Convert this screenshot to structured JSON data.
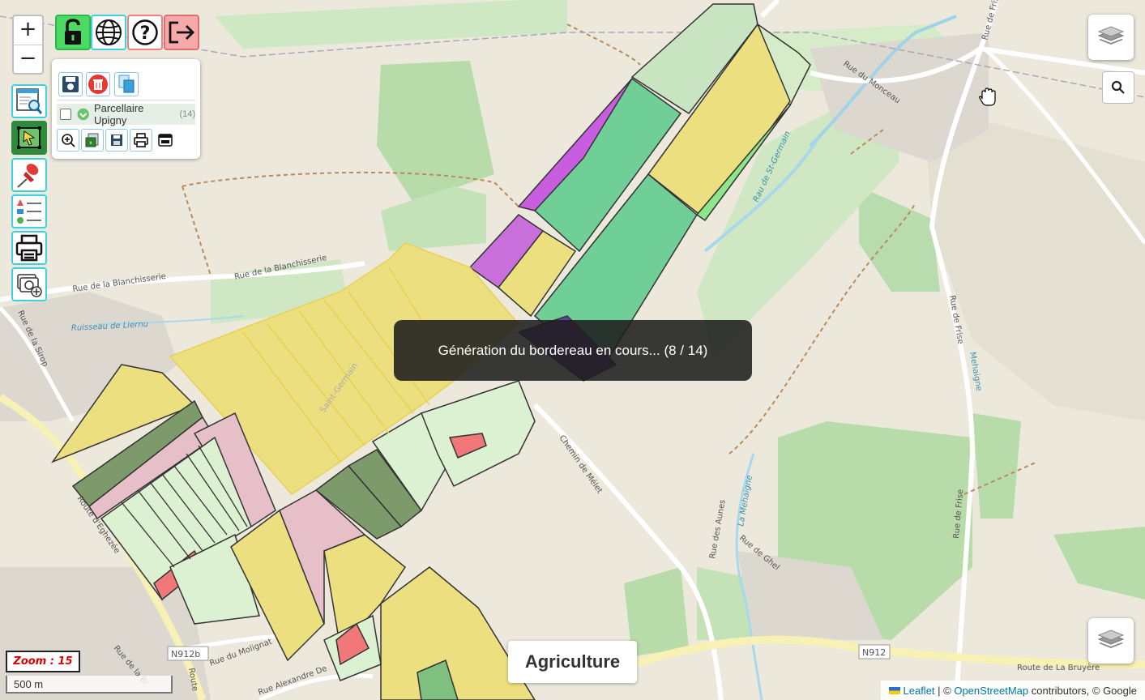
{
  "zoom_control": {
    "in_label": "+",
    "out_label": "−"
  },
  "toolbar": {
    "lock_icon": "unlock-icon",
    "globe_icon": "globe-icon",
    "help_label": "?",
    "logout_icon": "logout-icon",
    "lock_color": "#4cd964",
    "logout_color": "#f7a8a8"
  },
  "sidebar": {
    "items": [
      {
        "name": "map-search-icon"
      },
      {
        "name": "select-area-icon"
      },
      {
        "name": "pin-icon"
      },
      {
        "name": "legend-icon"
      },
      {
        "name": "print-icon"
      },
      {
        "name": "photo-add-icon"
      }
    ]
  },
  "layer_panel": {
    "layer_name": "Parcellaire Upigny",
    "layer_count": "(14)",
    "top_buttons": [
      "save-icon",
      "delete-icon",
      "copy-icon"
    ],
    "bottom_buttons": [
      "zoom-to-layer-icon",
      "export-icon",
      "save-small-icon",
      "print-small-icon",
      "screen-icon"
    ]
  },
  "toast": {
    "text": "Génération du bordereau en cours... (8 / 14)"
  },
  "base_button": {
    "label": "Agriculture"
  },
  "zoom_label": {
    "text": "Zoom : 15"
  },
  "scale": {
    "text": "500 m"
  },
  "attribution": {
    "leaflet": "Leaflet",
    "sep": " | © ",
    "osm": "OpenStreetMap",
    "rest": " contributors, © Google"
  },
  "map_labels": {
    "rue_blanchisserie_1": "Rue de la Blanchisserie",
    "rue_blanchisserie_2": "Rue de la Blanchisserie",
    "ruisseau_liernu": "Ruisseau de Liernu",
    "saint_germain": "Saint-Germain",
    "rue_monceau": "Rue du Monceau",
    "rue_frise_1": "Rue de Frise",
    "rue_frise_2": "Rue de Frise",
    "rue_frise_3": "Rue de Frise",
    "mehaigne_1": "Mehaigne",
    "mehaigne_2": "La Mehaigne",
    "chemin_melet": "Chemin de Mélet",
    "rue_aunes": "Rue des Aunes",
    "rue_ghel": "Rue de Ghel",
    "rue_molignat": "Rue du Molignat",
    "route_bruyere": "Route de La Bruyère",
    "n912b": "N912b",
    "n912": "N912",
    "rue_alexandre": "Rue Alexandre De",
    "rue_brigade": "Rue de la Br",
    "route_label": "Route",
    "rue_sirop": "Rue de la Sirop",
    "route_eghezee": "Route d'Eghezée",
    "ruisseau_st_germain": "Rau de St-Germain"
  }
}
